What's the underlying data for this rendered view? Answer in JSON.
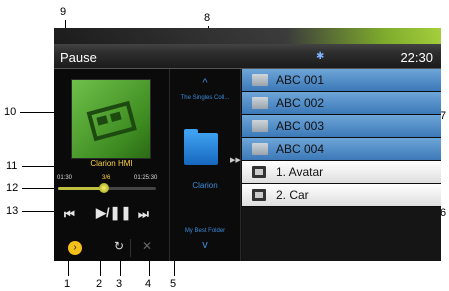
{
  "callouts": [
    "1",
    "2",
    "3",
    "4",
    "5",
    "6",
    "7",
    "8",
    "9",
    "10",
    "11",
    "12",
    "13"
  ],
  "status": {
    "mode": "Pause",
    "time": "22:30",
    "bluetooth_icon": "bluetooth-icon"
  },
  "player": {
    "track_title": "Clarion HMI",
    "elapsed": "01:30",
    "track_index": "3/6",
    "total": "01:25:30",
    "progress": 0.47,
    "prev_glyph": "⏮",
    "playpause_glyph": "▶/❚❚",
    "next_glyph": "⏭",
    "more_glyph": "›",
    "repeat_glyph": "↻",
    "shuffle_glyph": "✕"
  },
  "browser": {
    "up_arrow": "^",
    "prev_folder": "The Singles Coll...",
    "current_folder": "Clarion",
    "next_folder": "My Best Folder",
    "down_arrow": "v",
    "arrows": "▶▶"
  },
  "list": {
    "folders": [
      "ABC 001",
      "ABC 002",
      "ABC 003",
      "ABC 004"
    ],
    "files": [
      "1. Avatar",
      "2. Car"
    ]
  }
}
